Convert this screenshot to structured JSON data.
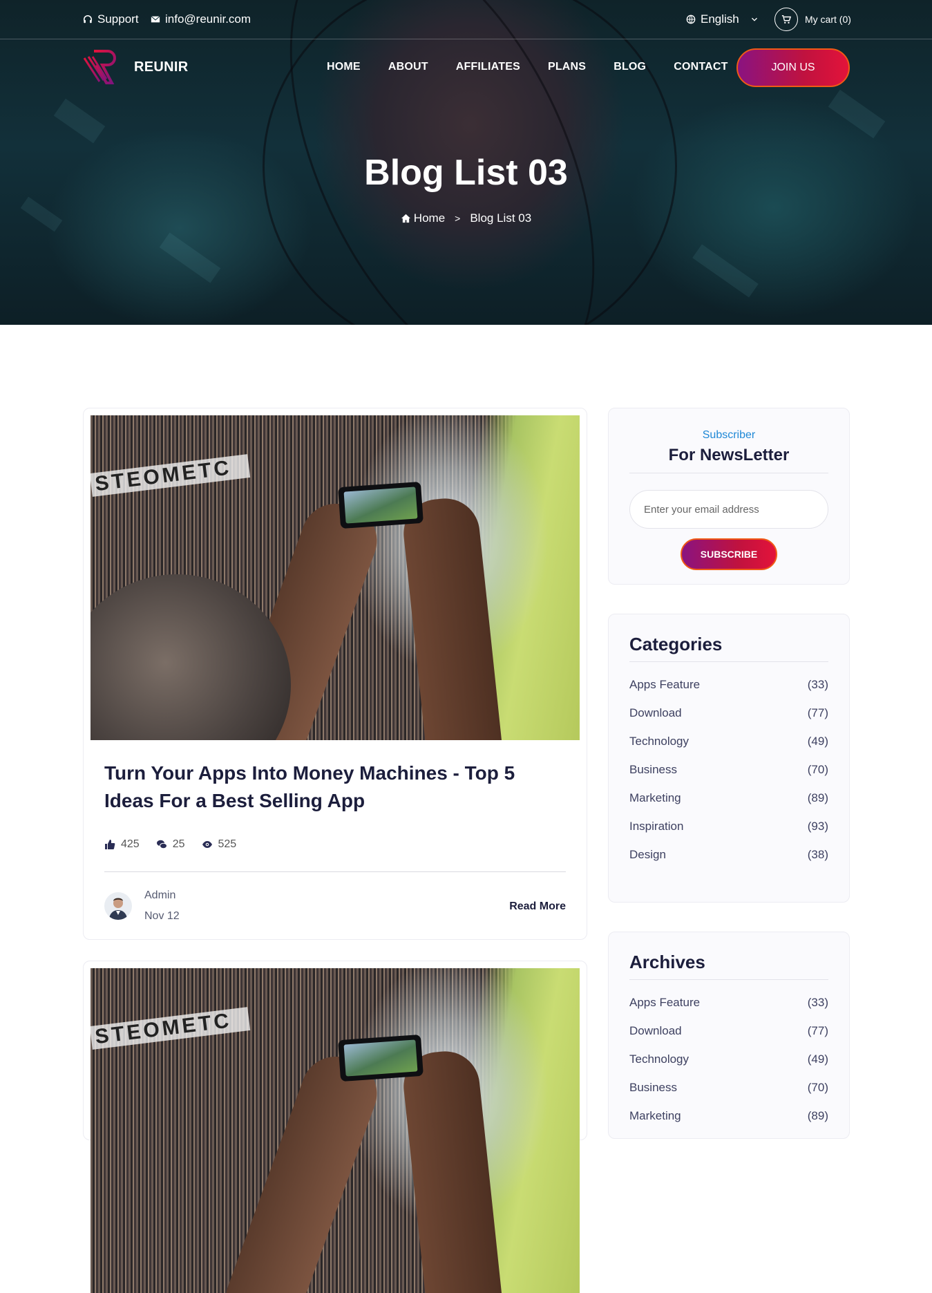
{
  "topbar": {
    "support": "Support",
    "email": "info@reunir.com",
    "language": "English",
    "cart": "My cart (0)"
  },
  "nav": {
    "brand": "REUNIR",
    "links": [
      "HOME",
      "ABOUT",
      "AFFILIATES",
      "PLANS",
      "BLOG",
      "CONTACT"
    ],
    "cta": "JOIN US"
  },
  "hero": {
    "title": "Blog List 03",
    "breadcrumb_home": "Home",
    "breadcrumb_sep": ">",
    "breadcrumb_current": "Blog List 03"
  },
  "posts": [
    {
      "image_banner": "STEOMETC",
      "title": "Turn Your Apps Into Money Machines - Top 5 Ideas For a Best Selling App",
      "likes": "425",
      "comments": "25",
      "views": "525",
      "author": "Admin",
      "date": "Nov 12",
      "read_more": "Read More"
    },
    {
      "image_banner": "STEOMETC"
    }
  ],
  "newsletter": {
    "eyebrow": "Subscriber",
    "title": "For NewsLetter",
    "placeholder": "Enter your email address",
    "button": "SUBSCRIBE"
  },
  "categories": {
    "title": "Categories",
    "items": [
      {
        "label": "Apps Feature",
        "count": "(33)"
      },
      {
        "label": "Download",
        "count": "(77)"
      },
      {
        "label": "Technology",
        "count": "(49)"
      },
      {
        "label": "Business",
        "count": "(70)"
      },
      {
        "label": "Marketing",
        "count": "(89)"
      },
      {
        "label": "Inspiration",
        "count": "(93)"
      },
      {
        "label": "Design",
        "count": "(38)"
      }
    ]
  },
  "archives": {
    "title": "Archives",
    "items": [
      {
        "label": "Apps Feature",
        "count": "(33)"
      },
      {
        "label": "Download",
        "count": "(77)"
      },
      {
        "label": "Technology",
        "count": "(49)"
      },
      {
        "label": "Business",
        "count": "(70)"
      },
      {
        "label": "Marketing",
        "count": "(89)"
      }
    ]
  },
  "colors": {
    "accent_blue": "#1e88d6",
    "gradient_start": "#8a1380",
    "gradient_end": "#e3133a",
    "button_border": "#f05a16",
    "heading": "#1c1e3c"
  }
}
